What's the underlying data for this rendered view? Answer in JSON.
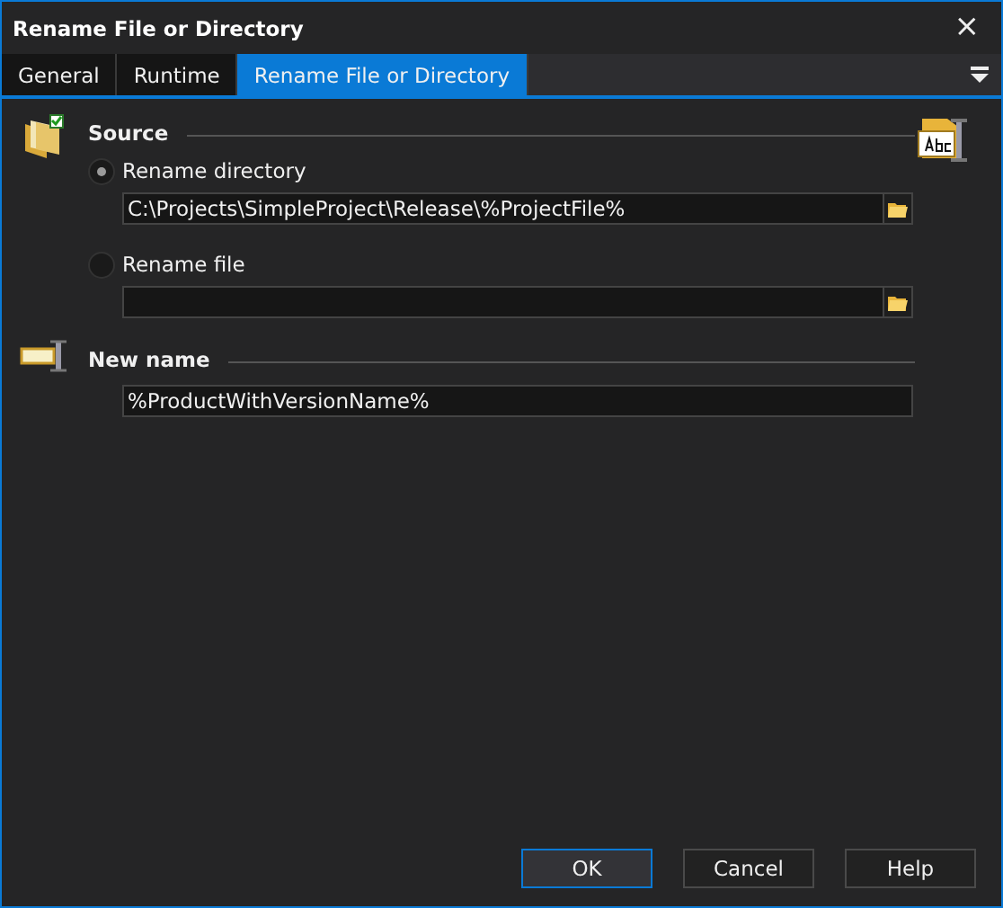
{
  "window": {
    "title": "Rename File or Directory",
    "close": "×"
  },
  "tabs": [
    {
      "label": "General",
      "selected": false
    },
    {
      "label": "Runtime",
      "selected": false
    },
    {
      "label": "Rename File or Directory",
      "selected": true
    }
  ],
  "source": {
    "heading": "Source",
    "options": [
      {
        "label": "Rename directory",
        "selected": true,
        "value": "C:\\Projects\\SimpleProject\\Release\\%ProjectFile%"
      },
      {
        "label": "Rename file",
        "selected": false
      }
    ]
  },
  "new_name": {
    "heading": "New name",
    "value": "%ProductWithVersionName%"
  },
  "buttons": [
    {
      "label": "OK",
      "default": true
    },
    {
      "label": "Cancel",
      "default": false
    },
    {
      "label": "Help",
      "default": false
    }
  ]
}
